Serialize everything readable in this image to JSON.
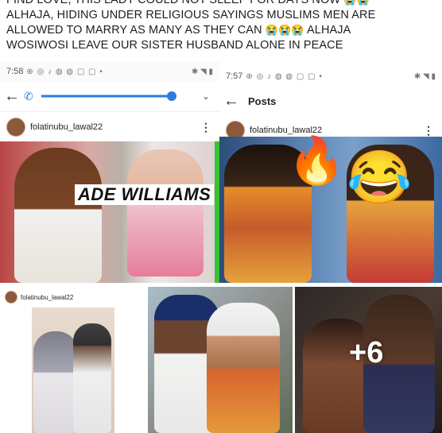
{
  "post": {
    "line1": "FIND LOVE, THIS LADY COULD NOT SLEEP FOR DAYS NOW",
    "line2": "ALHAJA, HIDING UNDER RELIGIOUS SAYINGS MUSLIMS MEN ARE",
    "line3a": "ALLOWED TO MARRY AS MANY AS THEY CAN",
    "line3b": "ALHAJA",
    "line4": "WOSIWOSI LEAVE OUR SISTER HUSBAND ALONE IN PEACE",
    "emoji": "😭"
  },
  "tile1": {
    "time": "7:58",
    "username": "folatinubu_lawal22",
    "overlay_text": "ADE WILLIAMS"
  },
  "tile2": {
    "time": "7:57",
    "title": "Posts",
    "username": "folatinubu_lawal22"
  },
  "tile3": {
    "username": "folatinubu_lawal22"
  },
  "tile5": {
    "more_count": "+6"
  },
  "icons": {
    "back": "back-arrow-icon",
    "more": "more-vertical-icon",
    "call": "phone-icon",
    "fire": "fire-emoji",
    "laugh": "laughing-emoji"
  }
}
